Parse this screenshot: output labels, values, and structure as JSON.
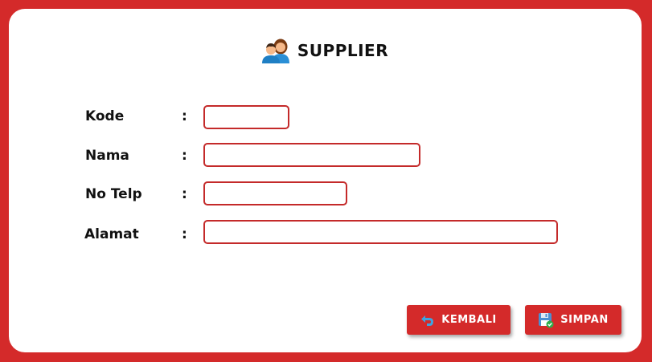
{
  "header": {
    "title": "SUPPLIER",
    "icon": "people-icon"
  },
  "form": {
    "fields": [
      {
        "label": "Kode",
        "separator": ":",
        "value": "",
        "placeholder": ""
      },
      {
        "label": "Nama",
        "separator": ":",
        "value": "",
        "placeholder": ""
      },
      {
        "label": "No Telp",
        "separator": ":",
        "value": "",
        "placeholder": ""
      },
      {
        "label": "Alamat",
        "separator": ":",
        "value": "",
        "placeholder": ""
      }
    ]
  },
  "actions": {
    "back": {
      "label": "KEMBALI",
      "icon": "undo-arrow-icon"
    },
    "save": {
      "label": "SIMPAN",
      "icon": "save-disk-icon"
    }
  },
  "colors": {
    "background": "#d42a2a",
    "card": "#ffffff",
    "field_border": "#c42a2a",
    "button": "#d42a2a"
  }
}
